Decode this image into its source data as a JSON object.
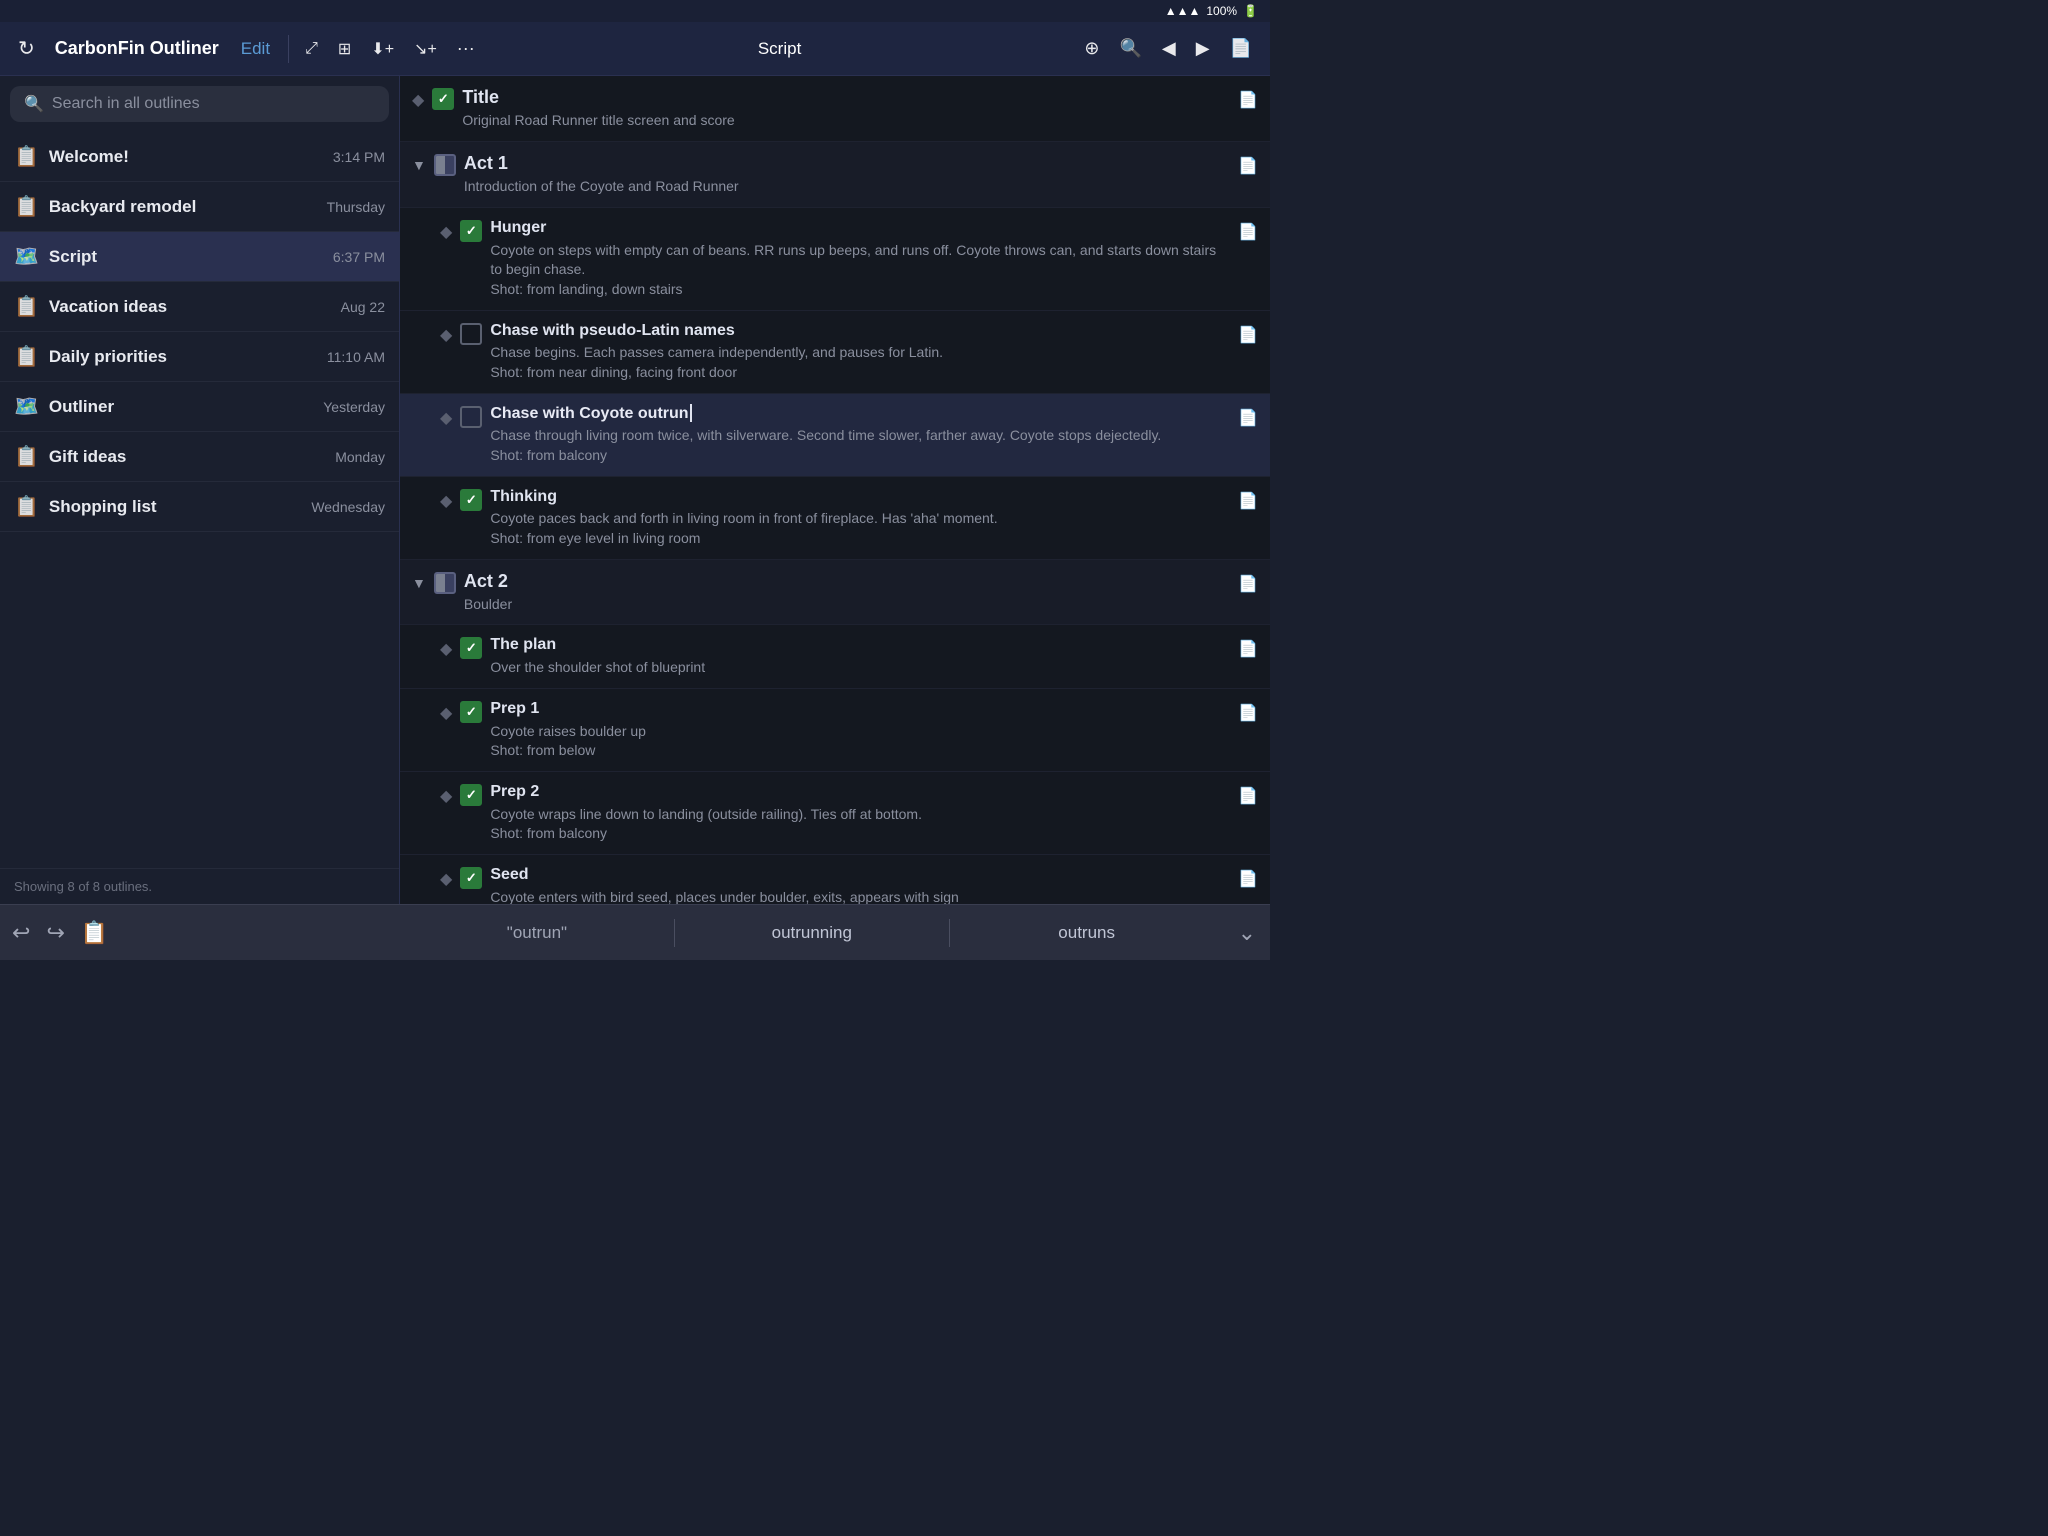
{
  "status_bar": {
    "wifi": "wifi",
    "battery": "100%"
  },
  "toolbar": {
    "refresh_icon": "↻",
    "title": "CarbonFin Outliner",
    "edit_label": "Edit",
    "icon_resize": "⤢",
    "icon_info": "⊕",
    "icon_add_child": "↙+",
    "icon_add_sibling": "↘+",
    "icon_more": "···",
    "script_label": "Script",
    "icon_move": "⊕",
    "icon_search": "🔍",
    "icon_back": "◀",
    "icon_forward": "▶",
    "icon_note": "📋"
  },
  "sidebar": {
    "search_placeholder": "Search in all outlines",
    "items": [
      {
        "id": "welcome",
        "name": "Welcome!",
        "date": "3:14 PM",
        "icon": "📋"
      },
      {
        "id": "backyard",
        "name": "Backyard remodel",
        "date": "Thursday",
        "icon": "📋"
      },
      {
        "id": "script",
        "name": "Script",
        "date": "6:37 PM",
        "icon": "📋",
        "active": true
      },
      {
        "id": "vacation",
        "name": "Vacation ideas",
        "date": "Aug 22",
        "icon": "📋"
      },
      {
        "id": "daily",
        "name": "Daily priorities",
        "date": "11:10 AM",
        "icon": "📋"
      },
      {
        "id": "outliner",
        "name": "Outliner",
        "date": "Yesterday",
        "icon": "📋"
      },
      {
        "id": "gift",
        "name": "Gift ideas",
        "date": "Monday",
        "icon": "📋"
      },
      {
        "id": "shopping",
        "name": "Shopping list",
        "date": "Wednesday",
        "icon": "📋"
      }
    ],
    "footer": "Showing 8 of 8 outlines."
  },
  "content": {
    "rows": [
      {
        "id": "title",
        "type": "item",
        "level": 0,
        "checkbox": "checked",
        "title": "Title",
        "note": "Original Road Runner title screen and score",
        "has_note_icon": true
      },
      {
        "id": "act1",
        "type": "section",
        "level": 0,
        "checkbox": "half",
        "title": "Act 1",
        "note": "Introduction of the Coyote and Road Runner",
        "has_note_icon": true,
        "collapsed": true
      },
      {
        "id": "hunger",
        "type": "item",
        "level": 1,
        "checkbox": "checked",
        "title": "Hunger",
        "note": "Coyote on steps with empty can of beans. RR runs up beeps, and runs off. Coyote throws can, and starts down stairs to begin chase.\nShot: from landing, down stairs",
        "has_note_icon": true
      },
      {
        "id": "chase_latin",
        "type": "item",
        "level": 1,
        "checkbox": "unchecked",
        "title": "Chase with pseudo-Latin names",
        "note": "Chase begins. Each passes camera independently, and pauses for Latin.\nShot: from near dining, facing front door",
        "has_note_icon": true
      },
      {
        "id": "chase_coyote",
        "type": "item",
        "level": 1,
        "checkbox": "unchecked",
        "title": "Chase with Coyote outrun",
        "note": "Chase through living room twice, with silverware. Second time slower, farther away. Coyote stops dejectedly.\nShot: from balcony",
        "has_note_icon": true,
        "editing": true
      },
      {
        "id": "thinking",
        "type": "item",
        "level": 1,
        "checkbox": "checked",
        "title": "Thinking",
        "note": "Coyote paces back and forth in living room in front of fireplace. Has 'aha' moment.\nShot: from eye level in living room",
        "has_note_icon": true
      },
      {
        "id": "act2",
        "type": "section",
        "level": 0,
        "checkbox": "half",
        "title": "Act 2",
        "note": "Boulder",
        "has_note_icon": true,
        "collapsed": true
      },
      {
        "id": "the_plan",
        "type": "item",
        "level": 1,
        "checkbox": "checked",
        "title": "The plan",
        "note": "Over the shoulder shot of blueprint",
        "has_note_icon": true
      },
      {
        "id": "prep1",
        "type": "item",
        "level": 1,
        "checkbox": "checked",
        "title": "Prep 1",
        "note": "Coyote raises boulder up\nShot: from below",
        "has_note_icon": true
      },
      {
        "id": "prep2",
        "type": "item",
        "level": 1,
        "checkbox": "checked",
        "title": "Prep 2",
        "note": "Coyote wraps line down to landing (outside railing). Ties off at bottom.\nShot: from balcony",
        "has_note_icon": true
      },
      {
        "id": "seed",
        "type": "item",
        "level": 1,
        "checkbox": "checked",
        "title": "Seed",
        "note": "Coyote enters with bird seed, places under boulder, exits, appears with sign",
        "has_note_icon": true
      }
    ]
  },
  "keyboard_bar": {
    "undo_icon": "↩",
    "redo_icon": "↪",
    "clipboard_icon": "📋",
    "suggestions": [
      {
        "text": "\"outrun\"",
        "quoted": true
      },
      {
        "text": "outrunning",
        "quoted": false
      },
      {
        "text": "outruns",
        "quoted": false
      }
    ],
    "chevron_down": "⌄"
  }
}
